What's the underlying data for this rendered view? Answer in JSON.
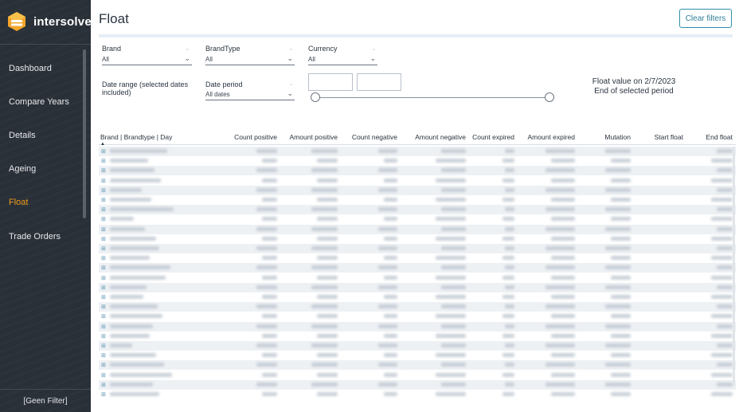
{
  "sidebar": {
    "brand": "intersolve",
    "items": [
      {
        "label": "Dashboard",
        "active": false
      },
      {
        "label": "Compare Years",
        "active": false
      },
      {
        "label": "Details",
        "active": false
      },
      {
        "label": "Ageing",
        "active": false
      },
      {
        "label": "Float",
        "active": true
      },
      {
        "label": "Trade Orders",
        "active": false
      }
    ],
    "footer": "[Geen Filter]"
  },
  "header": {
    "title": "Float",
    "clear_filters": "Clear filters"
  },
  "filters": {
    "brand": {
      "label": "Brand",
      "value": "All"
    },
    "brand_type": {
      "label": "BrandType",
      "value": "All"
    },
    "currency": {
      "label": "Currency",
      "value": "All"
    },
    "date_range": {
      "label": "Date range (selected dates included)"
    },
    "date_period": {
      "label": "Date period",
      "value": "All dates"
    }
  },
  "float_card": {
    "line1": "Float value on 2/7/2023",
    "line2": "End of selected period"
  },
  "table": {
    "columns": [
      "Brand | Brandtype | Day",
      "Count positive",
      "Amount positive",
      "Count negative",
      "Amount negative",
      "Count expired",
      "Amount expired",
      "Mutation",
      "Start float",
      "End float"
    ],
    "expander_glyph": "⊞",
    "sort_glyph": "▲"
  },
  "colors": {
    "sidebar_bg": "#2a3038",
    "active_nav": "#f29b1c",
    "accent": "#2f8fa8",
    "row_alt": "#eef1f4"
  },
  "icons": {
    "logo": "intersolve-logo-icon",
    "dropdown": "chevron-down-icon",
    "expand": "expand-row-icon",
    "sort": "sort-ascending-icon"
  }
}
